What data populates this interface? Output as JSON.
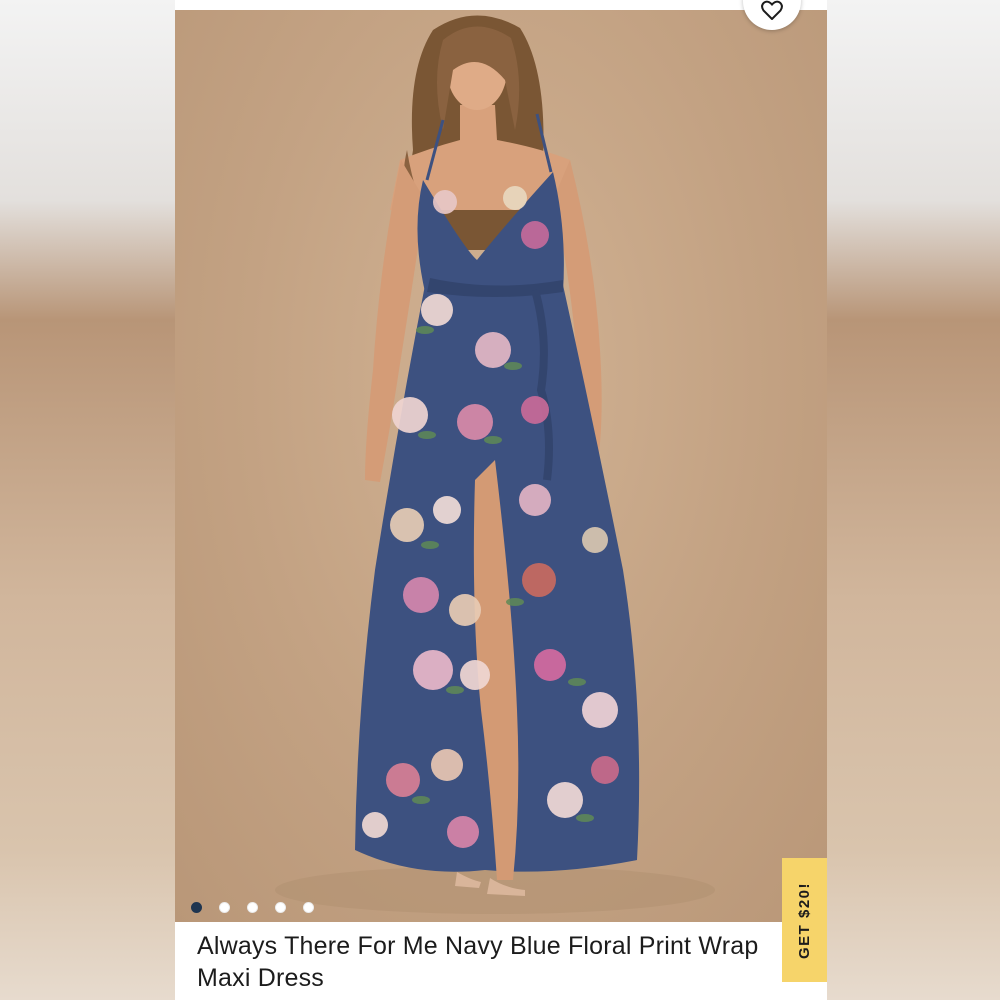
{
  "product": {
    "title": "Always There For Me Navy Blue Floral Print Wrap Maxi Dress",
    "image_count": 5,
    "active_image_index": 0
  },
  "promo": {
    "label": "GET $20!"
  },
  "icons": {
    "favorite": "heart-icon"
  },
  "colors": {
    "dress": "#3d5180",
    "background": "#c5a485",
    "promo": "#f6d46a",
    "active_dot": "#1f3550"
  }
}
